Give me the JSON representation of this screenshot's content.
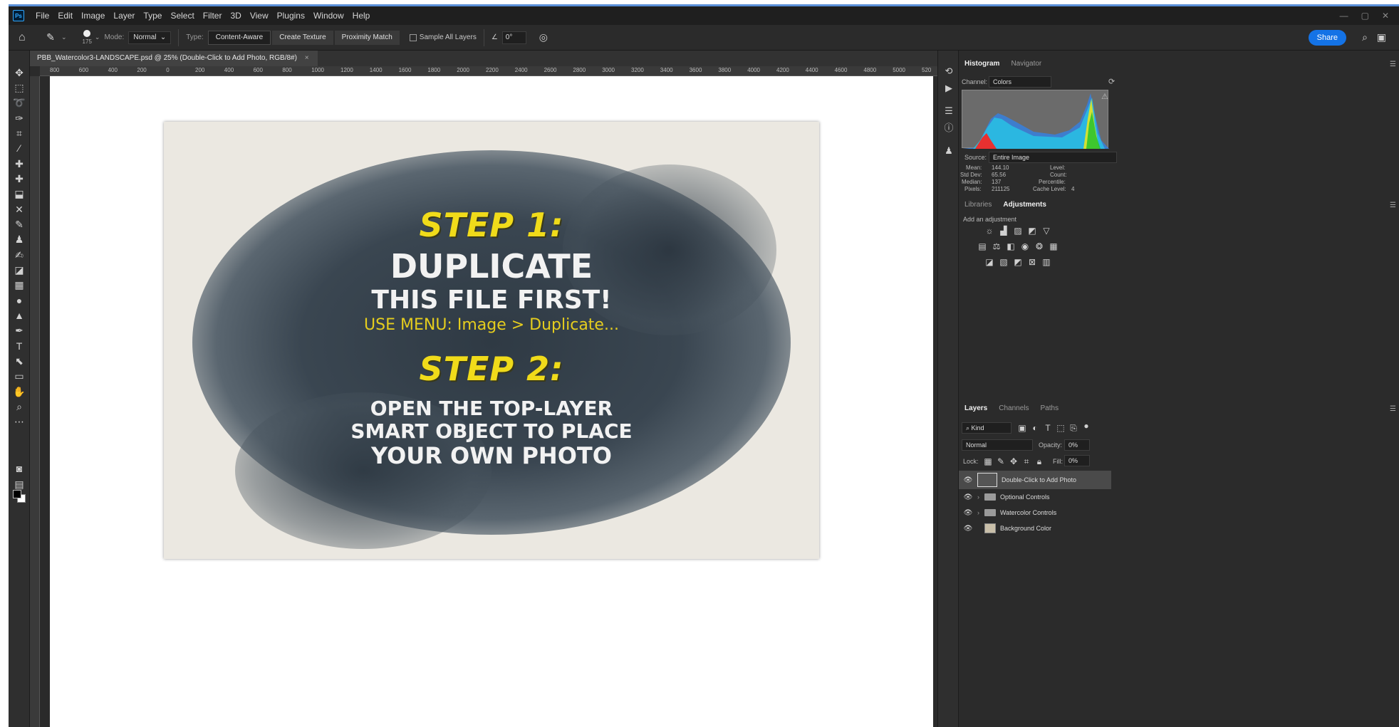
{
  "app": {
    "logo": "Ps",
    "menu": [
      "File",
      "Edit",
      "Image",
      "Layer",
      "Type",
      "Select",
      "Filter",
      "3D",
      "View",
      "Plugins",
      "Window",
      "Help"
    ],
    "window_controls": [
      "—",
      "▢",
      "✕"
    ]
  },
  "options": {
    "brush_size": "175",
    "mode_label": "Mode:",
    "mode_value": "Normal",
    "type_label": "Type:",
    "type_buttons": [
      "Content-Aware",
      "Create Texture",
      "Proximity Match"
    ],
    "sample_all_layers": "Sample All Layers",
    "angle_value": "0°",
    "share_label": "Share"
  },
  "document": {
    "tab_title": "PBB_Watercolor3-LANDSCAPE.psd @ 25% (Double-Click to Add Photo, RGB/8#)",
    "close": "×",
    "ruler_ticks": [
      "800",
      "600",
      "400",
      "200",
      "0",
      "200",
      "400",
      "600",
      "800",
      "1000",
      "1200",
      "1400",
      "1600",
      "1800",
      "2000",
      "2200",
      "2400",
      "2600",
      "2800",
      "3000",
      "3200",
      "3400",
      "3600",
      "3800",
      "4000",
      "4200",
      "4400",
      "4600",
      "4800",
      "5000",
      "520"
    ]
  },
  "artwork": {
    "step1": "STEP 1:",
    "line1": "DUPLICATE",
    "line2": "THIS FILE FIRST!",
    "menu_hint": "USE MENU: Image > Duplicate...",
    "step2": "STEP 2:",
    "line3": "OPEN THE TOP-LAYER",
    "line4": "SMART OBJECT TO PLACE",
    "line5": "YOUR OWN PHOTO"
  },
  "histogram": {
    "tabs": [
      "Histogram",
      "Navigator"
    ],
    "channel_label": "Channel:",
    "channel_value": "Colors",
    "source_label": "Source:",
    "source_value": "Entire Image",
    "stats_left": [
      {
        "label": "Mean:",
        "value": "144.10"
      },
      {
        "label": "Std Dev:",
        "value": "65.56"
      },
      {
        "label": "Median:",
        "value": "137"
      },
      {
        "label": "Pixels:",
        "value": "211125"
      }
    ],
    "stats_right": [
      {
        "label": "Level:",
        "value": ""
      },
      {
        "label": "Count:",
        "value": ""
      },
      {
        "label": "Percentile:",
        "value": ""
      },
      {
        "label": "Cache Level:",
        "value": "4"
      }
    ]
  },
  "adjustments": {
    "tabs": [
      "Libraries",
      "Adjustments"
    ],
    "add_label": "Add an adjustment"
  },
  "layers": {
    "tabs": [
      "Layers",
      "Channels",
      "Paths"
    ],
    "filter_kind": "Kind",
    "blend_mode": "Normal",
    "opacity_label": "Opacity:",
    "opacity_value": "0%",
    "lock_label": "Lock:",
    "fill_label": "Fill:",
    "fill_value": "0%",
    "items": [
      {
        "name": "Double-Click to Add Photo",
        "type": "smart-object"
      },
      {
        "name": "Optional Controls",
        "type": "group"
      },
      {
        "name": "Watercolor Controls",
        "type": "group"
      },
      {
        "name": "Background Color",
        "type": "fill"
      }
    ]
  },
  "colors": {
    "accent": "#1473e6",
    "step_yellow": "#f0db1a",
    "panel_bg": "#2b2b2b"
  }
}
